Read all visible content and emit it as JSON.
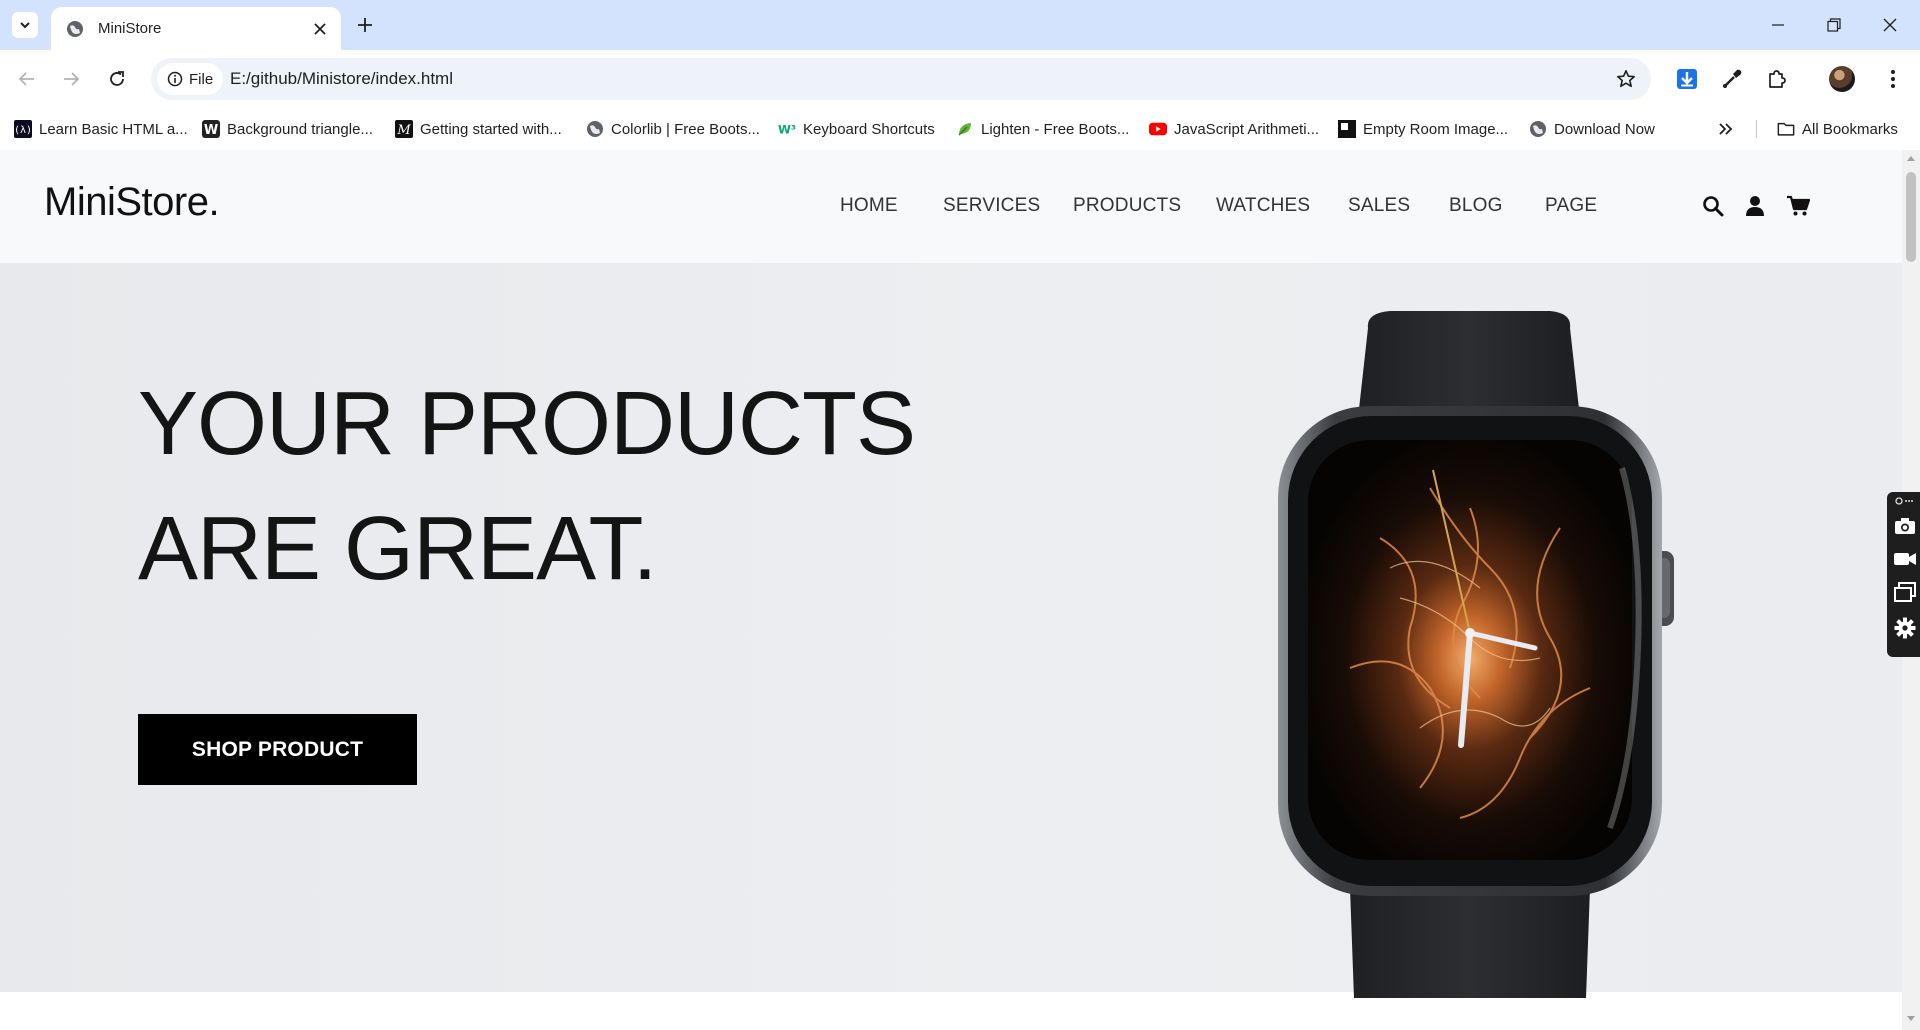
{
  "browser": {
    "tab_title": "MiniStore",
    "url_chip": "File",
    "url": "E:/github/Ministore/index.html",
    "bookmarks": [
      {
        "label": "Learn Basic HTML a...",
        "icon": "code-icon"
      },
      {
        "label": "Background triangle...",
        "icon": "w-icon"
      },
      {
        "label": "Getting started with...",
        "icon": "m-icon"
      },
      {
        "label": "Colorlib | Free Boots...",
        "icon": "globe-icon"
      },
      {
        "label": "Keyboard Shortcuts",
        "icon": "w3-icon"
      },
      {
        "label": "Lighten - Free Boots...",
        "icon": "leaf-icon"
      },
      {
        "label": "JavaScript Arithmeti...",
        "icon": "youtube-icon"
      },
      {
        "label": "Empty Room Image...",
        "icon": "image-icon"
      },
      {
        "label": "Download Now",
        "icon": "globe-icon"
      }
    ],
    "all_bookmarks": "All Bookmarks"
  },
  "site": {
    "logo": "MiniStore.",
    "nav": [
      "HOME",
      "SERVICES",
      "PRODUCTS",
      "WATCHES",
      "SALES",
      "BLOG",
      "PAGE"
    ],
    "hero": {
      "line1": "YOUR PRODUCTS",
      "line2": "ARE GREAT.",
      "button": "SHOP PRODUCT"
    }
  },
  "colors": {
    "tabstrip": "#d3e3fd",
    "hero_bg": "#eaecef",
    "button_bg": "#000000"
  }
}
